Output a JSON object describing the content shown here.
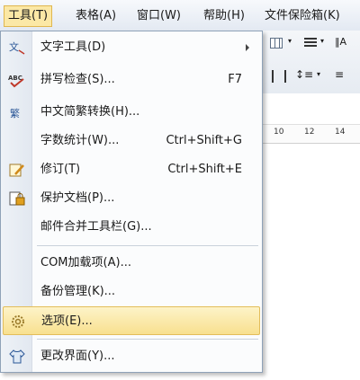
{
  "menubar": {
    "items": [
      {
        "label": "工具(T)"
      },
      {
        "label": "表格(A)"
      },
      {
        "label": "窗口(W)"
      },
      {
        "label": "帮助(H)"
      },
      {
        "label": "文件保险箱(K)"
      }
    ]
  },
  "ruler": {
    "ticks": [
      "10",
      "12",
      "14"
    ]
  },
  "tools_menu": {
    "items": [
      {
        "label": "文字工具(D)",
        "icon": "text-tool-icon",
        "submenu": true
      },
      {
        "label": "拼写检查(S)...",
        "shortcut": "F7",
        "icon": "spellcheck-icon"
      },
      {
        "label": "中文简繁转换(H)...",
        "icon": "chinese-convert-icon"
      },
      {
        "label": "字数统计(W)...",
        "shortcut": "Ctrl+Shift+G",
        "icon": ""
      },
      {
        "label": "修订(T)",
        "shortcut": "Ctrl+Shift+E",
        "icon": "track-changes-icon"
      },
      {
        "label": "保护文档(P)...",
        "icon": "protect-document-icon"
      },
      {
        "label": "邮件合并工具栏(G)...",
        "icon": ""
      },
      {
        "label": "COM加载项(A)...",
        "icon": ""
      },
      {
        "label": "备份管理(K)...",
        "icon": ""
      },
      {
        "label": "选项(E)...",
        "icon": "gear-icon",
        "highlighted": true
      },
      {
        "label": "更改界面(Y)...",
        "icon": "shirt-icon"
      }
    ]
  },
  "icon_glyphs": {
    "abc": "ABC",
    "jian": "繁"
  }
}
